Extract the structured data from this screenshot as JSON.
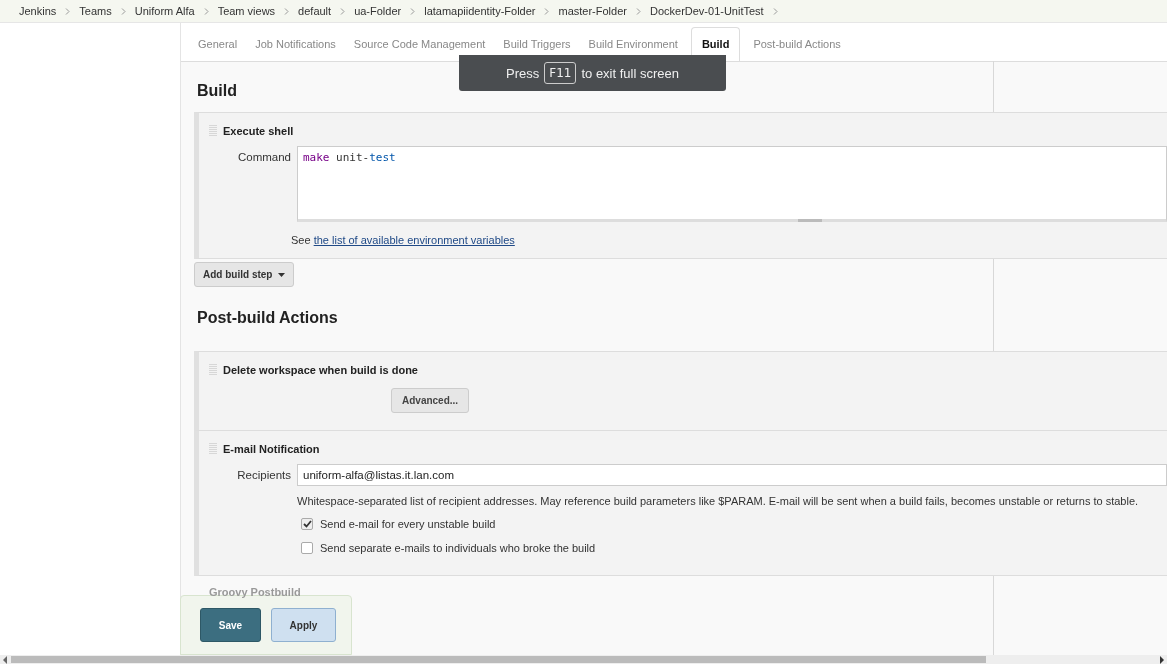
{
  "breadcrumbs": [
    "Jenkins",
    "Teams",
    "Uniform Alfa",
    "Team views",
    "default",
    "ua-Folder",
    "latamapiidentity-Folder",
    "master-Folder",
    "DockerDev-01-UnitTest"
  ],
  "tabs": [
    {
      "label": "General",
      "selected": false
    },
    {
      "label": "Job Notifications",
      "selected": false
    },
    {
      "label": "Source Code Management",
      "selected": false
    },
    {
      "label": "Build Triggers",
      "selected": false
    },
    {
      "label": "Build Environment",
      "selected": false
    },
    {
      "label": "Build",
      "selected": true
    },
    {
      "label": "Post-build Actions",
      "selected": false
    }
  ],
  "fullscreen_notice": {
    "before": "Press",
    "key": "F11",
    "after": "to exit full screen"
  },
  "build": {
    "heading": "Build",
    "step": {
      "title": "Execute shell",
      "command_label": "Command",
      "command_keyword": "make",
      "command_rest": " unit-",
      "command_target": "test",
      "help_prefix": "See",
      "help_link": "the list of available environment variables"
    },
    "add_button": "Add build step"
  },
  "post_build": {
    "heading": "Post-build Actions",
    "delete_workspace": {
      "title": "Delete workspace when build is done",
      "advanced_button": "Advanced..."
    },
    "email": {
      "title": "E-mail Notification",
      "recipients_label": "Recipients",
      "recipients_value": "uniform-alfa@listas.it.lan.com",
      "help": "Whitespace-separated list of recipient addresses. May reference build parameters like $PARAM. E-mail will be sent when a build fails, becomes unstable or returns to stable.",
      "options": [
        {
          "label": "Send e-mail for every unstable build",
          "checked": true
        },
        {
          "label": "Send separate e-mails to individuals who broke the build",
          "checked": false
        }
      ]
    },
    "next_title": "Groovy Postbuild"
  },
  "buttons": {
    "save": "Save",
    "apply": "Apply"
  }
}
